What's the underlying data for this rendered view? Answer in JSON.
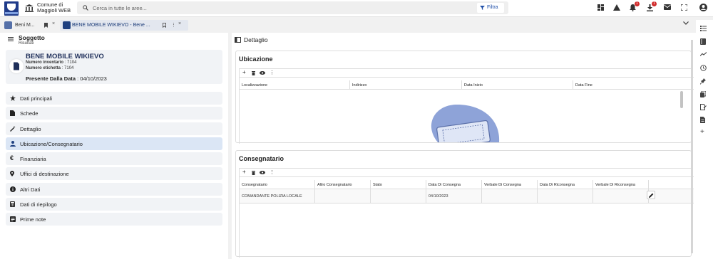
{
  "app": {
    "title_line1": "Comune di",
    "title_line2": "Maggioli WEB",
    "logo_text": "Maggioli"
  },
  "search": {
    "placeholder": "Cerca in tutte le aree...",
    "filter_label": "Filtra"
  },
  "topbar_icons": [
    "dashboard-icon",
    "warning-icon",
    "bell-icon",
    "download-icon",
    "mail-icon",
    "fullscreen-icon",
    "account-icon"
  ],
  "badges": {
    "bell": "1",
    "download": "1"
  },
  "tabs": [
    {
      "label": "Beni M...",
      "active": false
    },
    {
      "label": "BENE MOBILE WIKIEVO - Bene ...",
      "active": true
    }
  ],
  "left": {
    "header_title": "Soggetto",
    "header_sub": "Risultati",
    "card": {
      "title": "BENE MOBILE WIKIEVO",
      "inv_label": "Numero inventario",
      "inv_value": ": 7104",
      "etic_label": "Numero etichetta",
      "etic_value": ": 7104",
      "date_label": "Presente Dalla Data",
      "date_value": ": 04/10/2023"
    },
    "nav": [
      {
        "label": "Dati principali",
        "icon": "star-icon"
      },
      {
        "label": "Schede",
        "icon": "document-icon"
      },
      {
        "label": "Dettaglio",
        "icon": "magic-wand-icon"
      },
      {
        "label": "Ubicazione/Consegnatario",
        "icon": "person-icon",
        "active": true
      },
      {
        "label": "Finanziaria",
        "icon": "euro-icon"
      },
      {
        "label": "Uffici di destinazione",
        "icon": "location-pin-icon"
      },
      {
        "label": "Altri Dati",
        "icon": "info-icon"
      },
      {
        "label": "Dati di riepilogo",
        "icon": "calculator-icon"
      },
      {
        "label": "Prime note",
        "icon": "note-icon"
      }
    ]
  },
  "content": {
    "title": "Dettaglio",
    "ubicazione": {
      "title": "Ubicazione",
      "columns": [
        "Localizzazione",
        "Indirizzo",
        "Data Inizio",
        "Data Fine"
      ]
    },
    "consegnatario": {
      "title": "Consegnatario",
      "columns": [
        "Consegnatario",
        "Altro Consegnatario",
        "Stato",
        "Data Di Consegna",
        "Verbale Di Consegna",
        "Data Di Riconsegna",
        "Verbale Di Riconsegna"
      ],
      "rows": [
        [
          "COMANDANTE POLIZIA LOCALE",
          "",
          "",
          "04/10/2023",
          "",
          "",
          ""
        ]
      ]
    }
  },
  "colors": {
    "accent": "#1d3f80",
    "active_nav": "#dbe6f5",
    "badge": "#d12b2b",
    "logo": "#1f3b8a"
  }
}
